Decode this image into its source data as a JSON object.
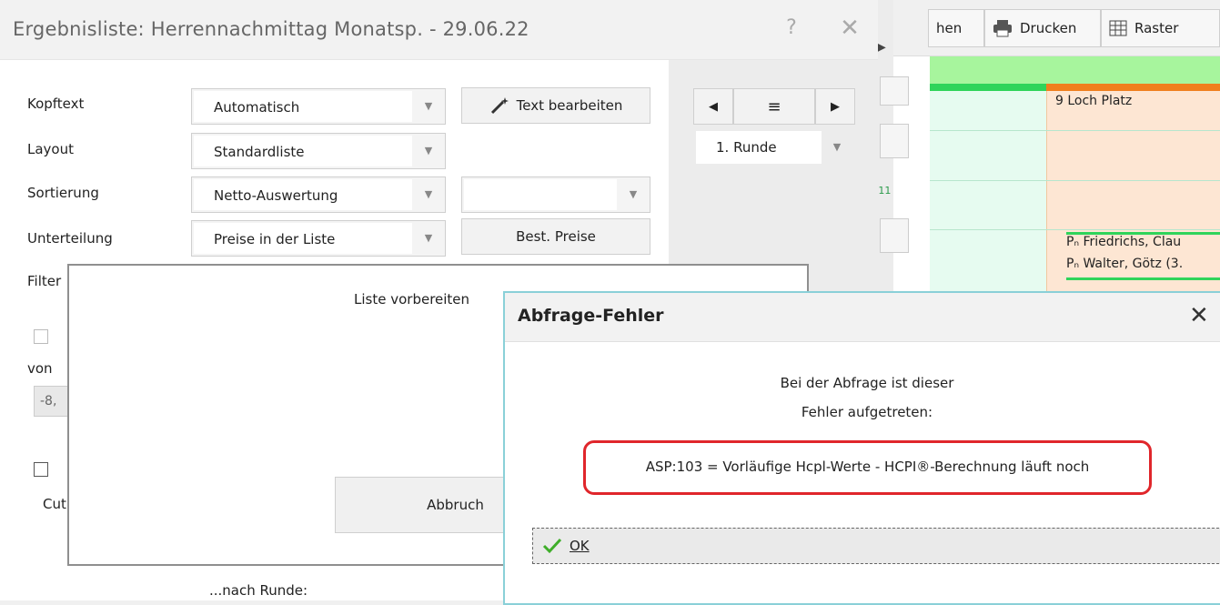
{
  "background_window": {
    "toolbar": {
      "partial_label": "hen",
      "print_label": "Drucken",
      "grid_label": "Raster"
    },
    "column_header": "9 Loch Platz",
    "f_key": "F11",
    "entries": [
      "Pₙ Friedrichs, Clau",
      "Pₙ Walter, Götz (3."
    ]
  },
  "main_dialog": {
    "title": "Ergebnisliste: Herrennachmittag Monatsp. - 29.06.22",
    "help": "?",
    "close": "✕",
    "fields": {
      "kopftext": {
        "label": "Kopftext",
        "value": "Automatisch"
      },
      "layout": {
        "label": "Layout",
        "value": "Standardliste"
      },
      "sortierung": {
        "label": "Sortierung",
        "value": "Netto-Auswertung",
        "secondary": ""
      },
      "unterteilung": {
        "label": "Unterteilung",
        "value": "Preise in der Liste"
      },
      "filter": {
        "label": "Filter"
      }
    },
    "text_bearbeiten": "Text bearbeiten",
    "best_preise": "Best. Preise",
    "runde": "1. Runde",
    "partials": {
      "von": "von",
      "value": "-8,",
      "cut": "Cut",
      "nach_runde": "...nach Runde:"
    }
  },
  "prep_dialog": {
    "title": "Liste vorbereiten",
    "cancel": "Abbruch"
  },
  "error_dialog": {
    "title": "Abfrage-Fehler",
    "close": "✕",
    "line1": "Bei der Abfrage ist dieser",
    "line2": "Fehler aufgetreten:",
    "error": "ASP:103 = Vorläufige Hcpl-Werte - HCPI®-Berechnung läuft noch",
    "ok": "OK"
  },
  "colors": {
    "highlight_border": "#e0262b",
    "dialog_border": "#8ad0d8",
    "green_row": "#a7f59d",
    "orange_col": "#fde6d3"
  }
}
